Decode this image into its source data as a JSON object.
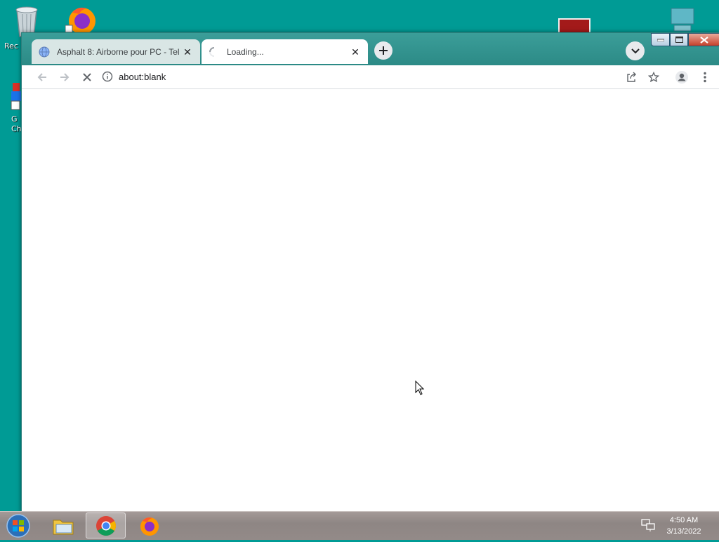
{
  "desktop": {
    "recycle_label": "Rec",
    "chrome_label_line1": "G",
    "chrome_label_line2": "Ch"
  },
  "browser": {
    "tabs": [
      {
        "title": "Asphalt 8: Airborne pour PC - Tel",
        "state": "inactive"
      },
      {
        "title": "Loading...",
        "state": "active"
      }
    ],
    "address": "about:blank"
  },
  "taskbar": {
    "time": "4:50 AM",
    "date": "3/13/2022"
  },
  "colors": {
    "desktop": "#009b95",
    "tabstrip": "#2c8a86",
    "active_tab": "#ffffff"
  }
}
